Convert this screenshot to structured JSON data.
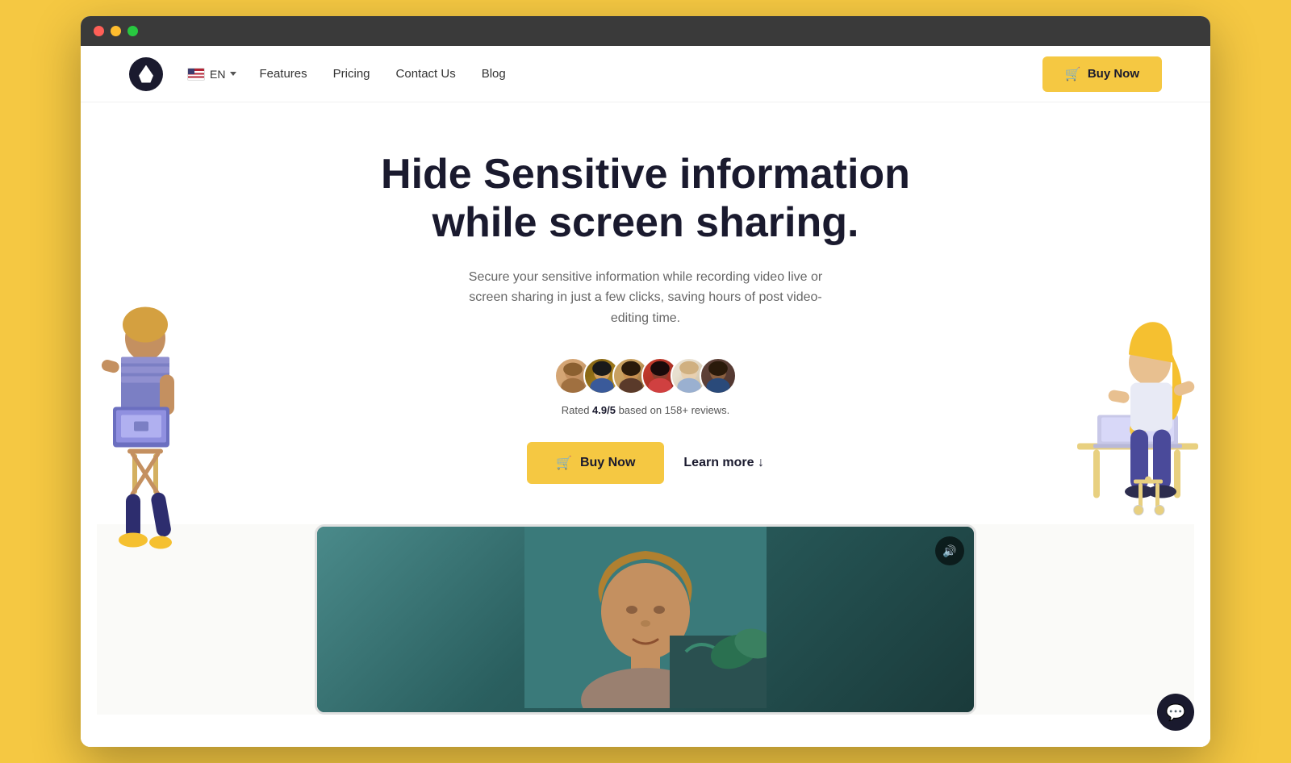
{
  "browser": {
    "traffic_lights": [
      "red",
      "yellow",
      "green"
    ]
  },
  "navbar": {
    "logo_alt": "App logo",
    "lang": "EN",
    "nav_links": [
      {
        "label": "Features",
        "id": "features"
      },
      {
        "label": "Pricing",
        "id": "pricing"
      },
      {
        "label": "Contact Us",
        "id": "contact"
      },
      {
        "label": "Blog",
        "id": "blog"
      }
    ],
    "buy_button": "Buy Now"
  },
  "hero": {
    "title_line1": "Hide Sensitive information",
    "title_line2": "while screen sharing.",
    "subtitle": "Secure your sensitive information while recording video live or screen sharing in just a few clicks, saving hours of post video-editing time.",
    "rating_text": "Rated ",
    "rating_value": "4.9/5",
    "rating_suffix": " based on 158+ reviews.",
    "avatars": [
      {
        "id": "av1",
        "color": "#d4a574"
      },
      {
        "id": "av2",
        "color": "#8B6914"
      },
      {
        "id": "av3",
        "color": "#c8a060"
      },
      {
        "id": "av4",
        "color": "#c0392b"
      },
      {
        "id": "av5",
        "color": "#e8e0d0"
      },
      {
        "id": "av6",
        "color": "#5d4037"
      }
    ],
    "buy_btn": "Buy Now",
    "learn_more": "Learn more ↓"
  },
  "video": {
    "sound_icon": "🔊"
  },
  "chat": {
    "icon": "💬"
  },
  "colors": {
    "accent": "#f5c842",
    "dark": "#1a1a2e",
    "bg": "#fafaf8"
  }
}
